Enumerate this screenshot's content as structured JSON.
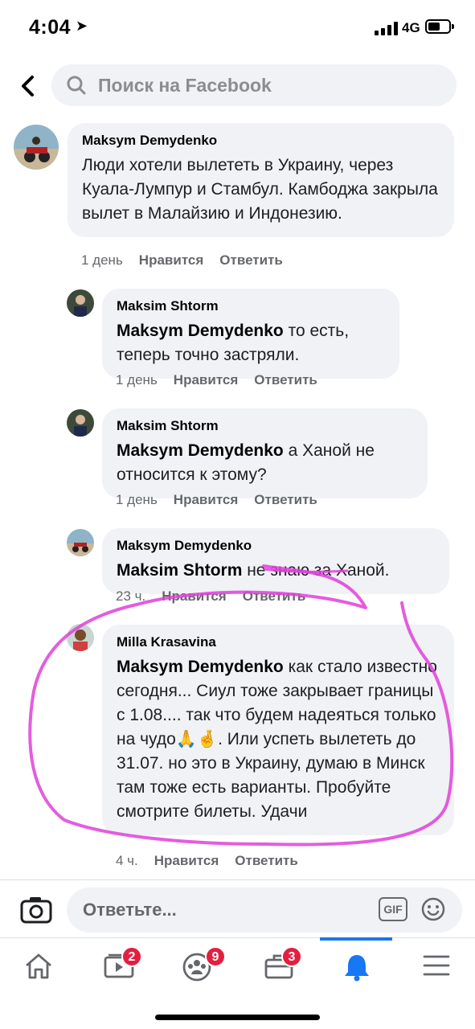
{
  "status_bar": {
    "time": "4:04",
    "network": "4G"
  },
  "header": {
    "search_placeholder": "Поиск на Facebook",
    "back_icon": "chevron-left-icon",
    "search_icon": "search-icon"
  },
  "comments": [
    {
      "author": "Maksym Demydenko",
      "mention": "",
      "text": "Люди хотели вылететь в Украину, через Куала-Лумпур и Стамбул. Камбоджа закрыла вылет в Малайзию и Индонезию.",
      "time": "1 день",
      "like": "Нравится",
      "reply": "Ответить"
    },
    {
      "author": "Maksim Shtorm",
      "mention": "Maksym Demydenko",
      "text": " то есть, теперь точно застряли.",
      "time": "1 день",
      "like": "Нравится",
      "reply": "Ответить"
    },
    {
      "author": "Maksim Shtorm",
      "mention": "Maksym Demydenko",
      "text": " а Ханой не относится к этому?",
      "time": "1 день",
      "like": "Нравится",
      "reply": "Ответить"
    },
    {
      "author": "Maksym Demydenko",
      "mention": "Maksim Shtorm",
      "text": " не знаю за Ханой.",
      "time": "23 ч.",
      "like": "Нравится",
      "reply": "Ответить"
    },
    {
      "author": "Milla Krasavina",
      "mention": "Maksym Demydenko",
      "text": " как стало известно сегодня... Сиул тоже закрывает границы с 1.08.... так что будем надеяться только на чудо🙏🤞. Или успеть вылететь до 31.07. но это в Украину, думаю в Минск там тоже есть варианты. Пробуйте смотрите билеты. Удачи",
      "time": "4 ч.",
      "like": "Нравится",
      "reply": "Ответить"
    }
  ],
  "composer": {
    "placeholder": "Ответьте...",
    "gif_label": "GIF"
  },
  "tabbar": {
    "items": [
      {
        "icon": "home-icon",
        "badge": ""
      },
      {
        "icon": "video-icon",
        "badge": "2"
      },
      {
        "icon": "groups-icon",
        "badge": "9"
      },
      {
        "icon": "marketplace-icon",
        "badge": "3"
      },
      {
        "icon": "bell-icon",
        "badge": ""
      },
      {
        "icon": "menu-icon",
        "badge": ""
      }
    ]
  },
  "colors": {
    "accent": "#1877f2",
    "bubble": "#f0f2f5",
    "badge": "#e41e3f",
    "annotation": "#e040d8"
  }
}
